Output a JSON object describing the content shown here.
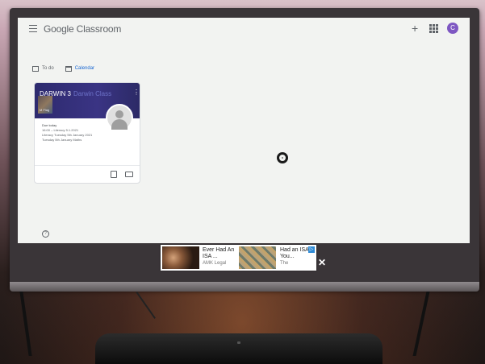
{
  "app": {
    "brand_google": "Google",
    "brand_product": "Classroom",
    "avatar_letter": "C",
    "plus_symbol": "+"
  },
  "nav": {
    "todo_label": "To do",
    "calendar_label": "Calendar"
  },
  "class_card": {
    "title": "DARWIN 3",
    "title_ghost": "Darwin Class",
    "subtitle": "M Flag",
    "more_symbol": "⋮",
    "due_label": "Due today",
    "due_items": [
      "16:00 – Literacy 5.1.2021",
      "Literacy Tuesday 5th January 2021",
      "Tuesday 5th January Maths"
    ]
  },
  "help": {
    "symbol": "?"
  },
  "ad": {
    "ad1_title": "Ever Had An ISA ...",
    "ad1_source": "AMK Legal",
    "ad2_title": "Had an ISA? You...",
    "ad2_source": "The",
    "badge_symbol": "▷",
    "close_symbol": "✕"
  },
  "colors": {
    "class_header": "#3a3484",
    "avatar": "#7e57c2",
    "link_blue": "#1967d2"
  },
  "icons": {
    "menu": "hamburger-menu-icon",
    "apps": "apps-grid-icon",
    "todo": "assignment-icon",
    "calendar": "calendar-icon",
    "folder": "folder-icon",
    "help": "help-icon",
    "close": "close-icon"
  }
}
